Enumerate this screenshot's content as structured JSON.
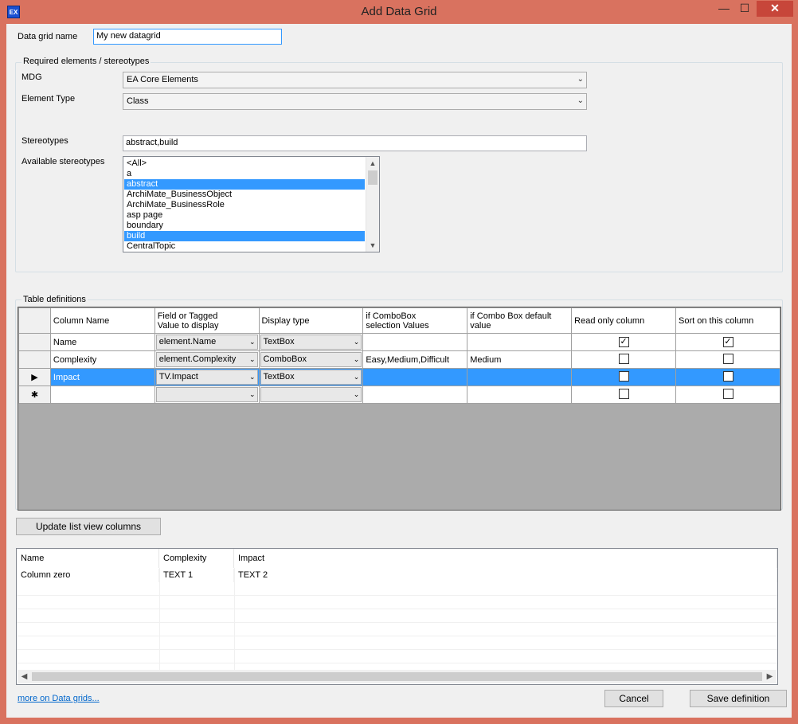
{
  "window": {
    "title": "Add Data Grid",
    "icon_text": "EX",
    "minimize": "—",
    "maximize": "☐",
    "close": "✕"
  },
  "name_field": {
    "label": "Data grid name",
    "value": "My new datagrid"
  },
  "required_group": {
    "title": "Required elements / stereotypes",
    "mdg_label": "MDG",
    "mdg_value": "EA Core Elements",
    "element_type_label": "Element Type",
    "element_type_value": "Class",
    "stereotypes_label": "Stereotypes",
    "stereotypes_value": "abstract,build",
    "available_label": "Available stereotypes",
    "available": [
      {
        "label": "<All>",
        "selected": false
      },
      {
        "label": "a",
        "selected": false
      },
      {
        "label": "abstract",
        "selected": true
      },
      {
        "label": "ArchiMate_BusinessObject",
        "selected": false
      },
      {
        "label": "ArchiMate_BusinessRole",
        "selected": false
      },
      {
        "label": "asp page",
        "selected": false
      },
      {
        "label": "boundary",
        "selected": false
      },
      {
        "label": "build",
        "selected": true
      },
      {
        "label": "CentralTopic",
        "selected": false
      }
    ]
  },
  "table_defs": {
    "title": "Table definitions",
    "headers": {
      "column_name": "Column Name",
      "field_line1": "Field or Tagged",
      "field_line2": "Value to display",
      "display_type": "Display type",
      "combo_values_line1": "if ComboBox",
      "combo_values_line2": "selection Values",
      "combo_default_line1": "if Combo Box default",
      "combo_default_line2": "value",
      "read_only": "Read only column",
      "sort": "Sort on this column"
    },
    "rows": [
      {
        "indicator": "",
        "name": "Name",
        "field": "element.Name",
        "display": "TextBox",
        "values": "",
        "default": "",
        "read_only": true,
        "sort": true
      },
      {
        "indicator": "",
        "name": "Complexity",
        "field": "element.Complexity",
        "display": "ComboBox",
        "values": "Easy,Medium,Difficult",
        "default": "Medium",
        "read_only": false,
        "sort": false
      },
      {
        "indicator": "▶",
        "name": "Impact",
        "field": "TV.Impact",
        "display": "TextBox",
        "values": "",
        "default": "",
        "read_only": false,
        "sort": false
      },
      {
        "indicator": "✱",
        "name": "",
        "field": "",
        "display": "",
        "values": "",
        "default": "",
        "read_only": false,
        "sort": false
      }
    ],
    "selected_row": 2
  },
  "update_button": "Update list view columns",
  "preview": {
    "headers": [
      "Name",
      "Complexity",
      "Impact"
    ],
    "row": [
      "Column zero",
      "TEXT 1",
      "TEXT 2"
    ]
  },
  "footer": {
    "link": "more on Data grids...",
    "cancel": "Cancel",
    "save": "Save definition"
  },
  "icons": {
    "dropdown_arrow": "⌄",
    "scroll_up": "▲",
    "scroll_down": "▼",
    "scroll_left": "◀",
    "scroll_right": "▶",
    "check": "✓"
  }
}
